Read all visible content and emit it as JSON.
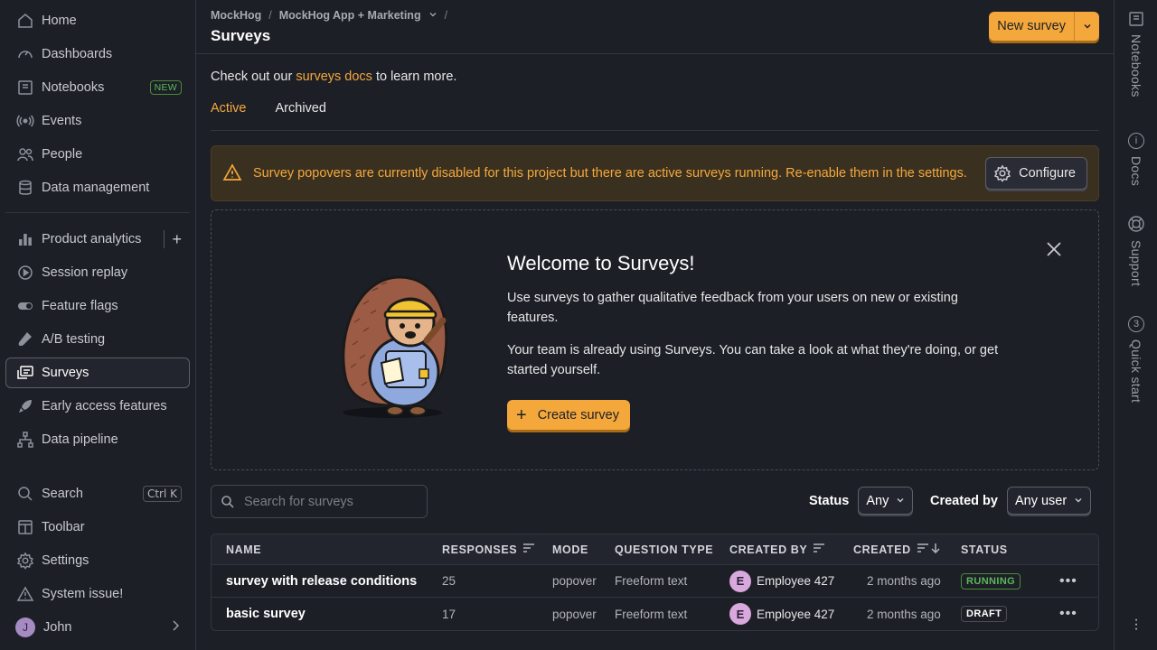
{
  "sidebar": {
    "items": [
      {
        "label": "Home",
        "icon": "home-icon"
      },
      {
        "label": "Dashboards",
        "icon": "dashboard-icon"
      },
      {
        "label": "Notebooks",
        "icon": "notebook-icon",
        "badge": "NEW"
      },
      {
        "label": "Events",
        "icon": "events-icon"
      },
      {
        "label": "People",
        "icon": "people-icon"
      },
      {
        "label": "Data management",
        "icon": "database-icon"
      }
    ],
    "products": [
      {
        "label": "Product analytics",
        "icon": "bar-chart-icon"
      },
      {
        "label": "Session replay",
        "icon": "replay-icon"
      },
      {
        "label": "Feature flags",
        "icon": "toggle-icon"
      },
      {
        "label": "A/B testing",
        "icon": "flask-icon"
      },
      {
        "label": "Surveys",
        "icon": "survey-icon"
      },
      {
        "label": "Early access features",
        "icon": "rocket-icon"
      },
      {
        "label": "Data pipeline",
        "icon": "pipeline-icon"
      }
    ],
    "bottom": [
      {
        "label": "Search",
        "icon": "search-icon",
        "shortcut": "Ctrl K"
      },
      {
        "label": "Toolbar",
        "icon": "toolbar-icon"
      },
      {
        "label": "Settings",
        "icon": "gear-icon"
      },
      {
        "label": "System issue!",
        "icon": "warning-icon"
      }
    ],
    "user": {
      "initial": "J",
      "name": "John"
    }
  },
  "right_sidebar": {
    "items": [
      {
        "label": "Notebooks",
        "icon": "notebook-icon"
      },
      {
        "label": "Docs",
        "icon": "info-icon"
      },
      {
        "label": "Support",
        "icon": "lifebuoy-icon"
      },
      {
        "label": "Quick start",
        "icon": "counter-icon",
        "count": "3"
      }
    ]
  },
  "header": {
    "breadcrumbs": [
      "MockHog",
      "MockHog App + Marketing"
    ],
    "title": "Surveys",
    "new_survey_label": "New survey"
  },
  "intro": {
    "prefix": "Check out our ",
    "link": "surveys docs",
    "suffix": " to learn more."
  },
  "tabs": [
    {
      "label": "Active",
      "active": true
    },
    {
      "label": "Archived",
      "active": false
    }
  ],
  "warning": {
    "text": "Survey popovers are currently disabled for this project but there are active surveys running. Re-enable them in the settings.",
    "button": "Configure"
  },
  "welcome": {
    "title": "Welcome to Surveys!",
    "p1": "Use surveys to gather qualitative feedback from your users on new or existing features.",
    "p2": "Your team is already using Surveys. You can take a look at what they're doing, or get started yourself.",
    "cta": "Create survey"
  },
  "filters": {
    "search_placeholder": "Search for surveys",
    "status_label": "Status",
    "status_value": "Any",
    "created_by_label": "Created by",
    "created_by_value": "Any user"
  },
  "table": {
    "headers": {
      "name": "NAME",
      "responses": "RESPONSES",
      "mode": "MODE",
      "question_type": "QUESTION TYPE",
      "created_by": "CREATED BY",
      "created": "CREATED",
      "status": "STATUS"
    },
    "rows": [
      {
        "name": "survey with release conditions",
        "responses": "25",
        "mode": "popover",
        "question_type": "Freeform text",
        "creator_initial": "E",
        "created_by": "Employee 427",
        "created": "2 months ago",
        "status": "RUNNING"
      },
      {
        "name": "basic survey",
        "responses": "17",
        "mode": "popover",
        "question_type": "Freeform text",
        "creator_initial": "E",
        "created_by": "Employee 427",
        "created": "2 months ago",
        "status": "DRAFT"
      }
    ]
  },
  "colors": {
    "accent": "#f4a83c",
    "background": "#1d1f27",
    "success": "#5cb85c"
  }
}
